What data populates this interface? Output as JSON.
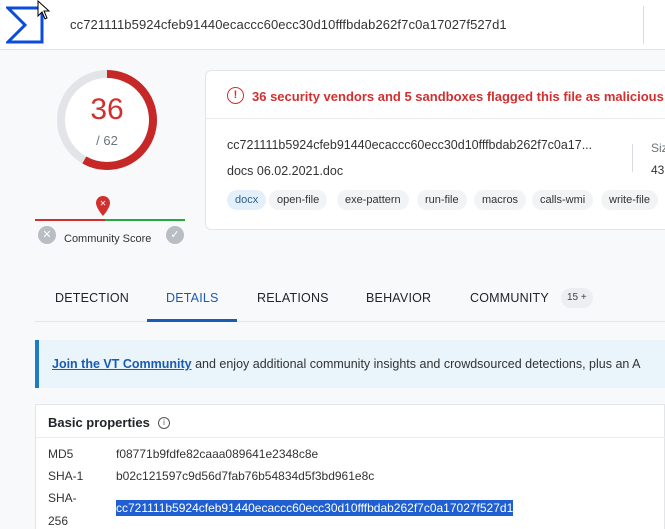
{
  "search": {
    "query": "cc721111b5924cfeb91440ecaccc60ecc30d10fffbdab262f7c0a17027f527d1"
  },
  "score": {
    "positives": "36",
    "total": "/ 62"
  },
  "community": {
    "label": "Community Score"
  },
  "alert": {
    "text": "36 security vendors and 5 sandboxes flagged this file as malicious"
  },
  "file": {
    "hash": "cc721111b5924cfeb91440ecaccc60ecc30d10fffbdab262f7c0a17...",
    "name": "docs 06.02.2021.doc",
    "size_label": "Siz",
    "size_value": "43",
    "tags": [
      "docx",
      "open-file",
      "exe-pattern",
      "run-file",
      "macros",
      "calls-wmi",
      "write-file"
    ]
  },
  "tabs": {
    "detection": "DETECTION",
    "details": "DETAILS",
    "relations": "RELATIONS",
    "behavior": "BEHAVIOR",
    "community": "COMMUNITY",
    "community_badge": "15 +"
  },
  "banner": {
    "link": "Join the VT Community",
    "text": " and enjoy additional community insights and crowdsourced detections, plus an A"
  },
  "basic_properties": {
    "title": "Basic properties",
    "rows": [
      {
        "key": "MD5",
        "value": "f08771b9fdfe82caaa089641e2348c8e"
      },
      {
        "key": "SHA-1",
        "value": "b02c121597c9d56d7fab76b54834d5f3bd961e8c"
      },
      {
        "key": "SHA-",
        "key2": "256",
        "value": "cc721111b5924cfeb91440ecaccc60ecc30d10fffbdab262f7c0a17027f527d1"
      }
    ]
  },
  "colors": {
    "malicious": "#d32f2f",
    "accent": "#1a5bb5",
    "selection": "#1f5fd2"
  }
}
